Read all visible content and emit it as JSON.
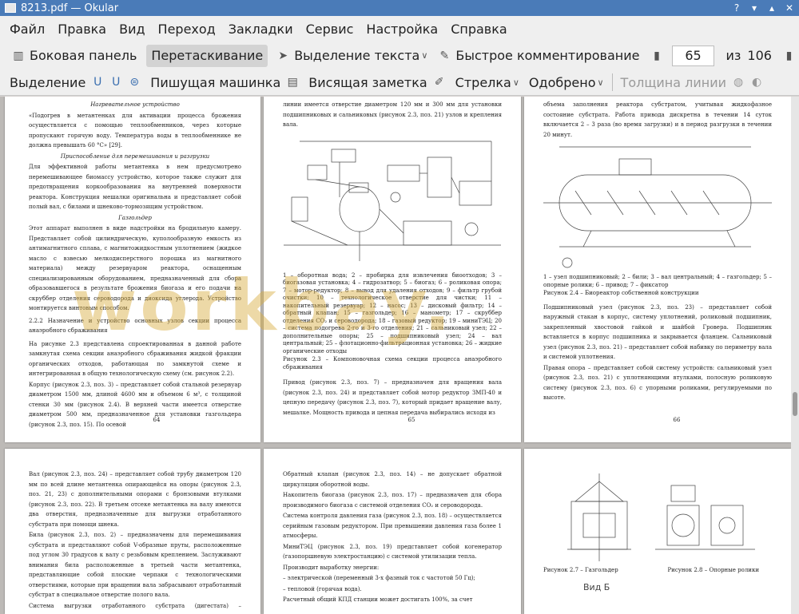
{
  "window": {
    "title": "8213.pdf  — Okular"
  },
  "menu": [
    "Файл",
    "Правка",
    "Вид",
    "Переход",
    "Закладки",
    "Сервис",
    "Настройка",
    "Справка"
  ],
  "toolbar1": {
    "sidebar": "Боковая панель",
    "browse": "Перетаскивание",
    "text_select": "Выделение текста",
    "quick_comment": "Быстрое комментирование",
    "page_current": "65",
    "page_of": "из",
    "page_total": "106"
  },
  "toolbar2": {
    "selection": "Выделение",
    "typewriter": "Пишущая машинка",
    "sticky_note": "Висящая заметка",
    "arrow": "Стрелка",
    "approved": "Одобрено",
    "line_width": "Толщина линии"
  },
  "watermark": "workbay.",
  "pages": {
    "p64": {
      "h1": "Нагревательное устройство",
      "t1": "«Подогрев в метантенках для активации процесса брожения осуществляется с помощью теплообменников, через которые пропускают горячую воду. Температура воды в теплообменнике не должна превышать 60 °С» [29].",
      "h2": "Приспособление для перемешивания и разгрузки",
      "t2": "Для эффективной работы метантенка в нем предусмотрено перемешивающее биомассу устройство, которое также служит для предотвращения коркообразования на внутренней поверхности реактора. Конструкция мешалки оригинальна и представляет собой полый вал, с билами и шнеково-тормозящим устройством.",
      "h3": "Газгольдер",
      "t3": "Этот аппарат выполнен в виде надстройки на бродильную камеру. Представляет собой цилиндрическую, куполообразную емкость из антимагнитного сплава, с магнитожидкостным уплотнением (жидкое масло с взвесью мелкодисперстного порошка из магнитного материала) между резервуаром реактора, оснащенным специализированным оборудованием, предназначенный для сбора образовавшегося в результате брожения биогаза и его подачи на скруббер отделения сероводорода и диоксида углерода. Устройство монтируется винтовым способом.",
      "t4": "2.2.2 Назначение и устройство основных узлов секции процесса анаэробного сбраживания",
      "t5": "На рисунке 2.3 представлена спроектированная в данной работе замкнутая схема секции анаэробного сбраживания жидкой фракции органических отходов, работающая по замкнутой схеме и интегрированная в общую технологическую схему (см. рисунок 2.2).",
      "t6": "Корпус (рисунок 2.3, поз. 3) – представляет собой стальной резервуар диаметром 1500 мм, длиной 4600 мм и объемом 6 м³, с толщиной стенки 30 мм (рисунок 2.4). В верхней части имеется отверстие диаметром 500 мм, предназначенное для установки газгольдера (рисунок 2.3, поз. 15). По осевой",
      "num": "64"
    },
    "p65": {
      "t1": "линии имеется отверстие диаметром 120 мм и 300 мм для установки подшипниковых и сальниковых (рисунок 2.3, поз. 21) узлов и крепления вала.",
      "legend": "1 – оборотная вода; 2 – пробирка для извлечения биоотходов; 3 – биогазовая установка; 4 – гидрозатвор; 5 – биогаз; 6 – роликовая опора; 7 – мотор-редуктор; 8 – вывод для удаления отходов; 9 – фильтр грубой очистки; 10 – технологическое отверстие для чистки; 11 – накопительный резервуар; 12 – насос; 13 – дисковый фильтр; 14 – обратный клапан; 15 – газгольдер; 16 – манометр; 17 – скруббер отделения CO₂ и сероводорода; 18 – газовый редуктор; 19 – миниТЭЦ; 20 – система подогрева 2-го и 3-го отделения; 21 – сальниковый узел; 22 – дополнительные опоры; 25 – подшипниковый узел; 24 – вал центральный; 25 – флотационно-фильтрационная установка; 26 – жидкие органические отходы",
      "caption": "Рисунок 2.3 – Компоновочная схема секции процесса анаэробного сбраживания",
      "t2": "Привод (рисунок 2.3, поз. 7) – предназначен для вращения вала (рисунок 2.3, поз. 24) и представляет собой мотор редуктор ЗМП-40 и цепную передачу (рисунок 2.3, поз. 7), который придает вращение валу, мешалке. Мощность привода и цепная передача выбирались исходя из",
      "num": "65"
    },
    "p66": {
      "t1": "объема заполнения реактора субстратом, учитывая жидкофазное состояние субстрата. Работа привода дискретна в течении 14 суток включается 2 – 3 раза (во время загрузки) и в период разгрузки в течении 20 минут.",
      "legend": "1 – узел подшипниковый; 2 – били; 3 – вал центральный; 4 – газгольдер; 5 – опорные ролики; 6 – привод; 7 – фиксатор",
      "caption": "Рисунок 2.4 – Биореактор собственной конструкции",
      "t2": "Подшипниковый узел (рисунок 2.3, поз. 23) – представляет собой наружный стакан в корпус, систему уплотнений, роликовый подшипник, закрепленный хвостовой гайкой и шайбой Гровера. Подшипник вставляется в корпус подшипника и закрывается фланцем. Сальниковый узел (рисунок 2.3, поз. 21) – представляет собой набивку по периметру вала и системой уплотнения.",
      "t3": "Правая опора – представляет собой систему устройств: сальниковый узел (рисунок 2.3, поз. 21) с уплотняющими втулками, полосную роликовую систему (рисунок 2.3, поз. 6) с упорными роликами, регулируемыми по высоте.",
      "num": "66"
    },
    "p67": {
      "t1": "Вал (рисунок 2.3, поз. 24) – представляет собой трубу диаметром 120 мм по всей длине метантенка опирающейся на опоры (рисунок 2.3, поз. 21, 23) с дополнительными опорами с бронзовыми втулками (рисунок 2.3, поз. 22). В третьем отсеке метантенка на валу имеются два отверстия, предназначенные для выгрузки отработанного субстрата при помощи шнека.",
      "t2": "Била (рисунок 2.3, поз. 2) – предназначены для перемешивания субстрата и представляют собой V-образные пруты, расположенные под углом 30 градусов к валу с резьбовым креплением. Заслуживают внимания била расположенные в третьей части метантенка, представляющие собой плоские черпаки с технологическими отверстиями, которые при вращении вала забрасывают отработанный субстрат в специальное отверстие полого вала.",
      "t3": "Система выгрузки отработанного субстрата (дигестата) – представляет"
    },
    "p68": {
      "t1": "Обратный клапан (рисунок 2.3, поз. 14) – не допускает обратной циркуляции оборотной воды.",
      "t2": "Накопитель биогаза (рисунок 2.3, поз. 17) – предназначен для сбора производимого биогаза с системой отделения CO₂ и сероводорода.",
      "t3": "Система контроля давления газа (рисунок 2.3, поз. 18) – осуществляется серийным газовым редуктором. При превышении давления газа более 1 атмосферы.",
      "t4": "МиниТЭЦ (рисунок 2.3, поз. 19) представляет собой когенератор (газопоршневую электростанцию) с системой утилизации тепла.",
      "t5": "Производит выработку энергии:",
      "t6": "– электрической (переменный 3-х фазный ток с частотой 50 Гц);",
      "t7": "– тепловой (горячая вода).",
      "t8": "Расчетный общий КПД станции может достигать 100%, за счет"
    },
    "p69": {
      "cap1": "Рисунок 2.7 – Газгольдер",
      "cap2": "Рисунок 2.8 – Опорные ролики",
      "label": "Вид Б"
    }
  }
}
